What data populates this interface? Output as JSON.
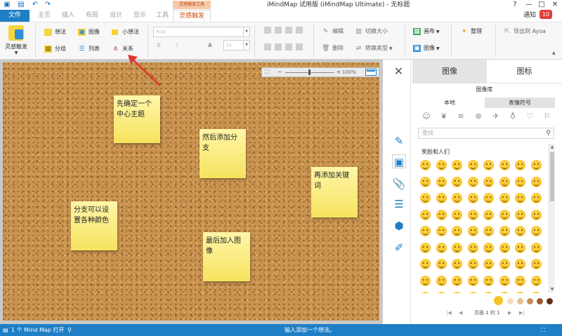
{
  "window": {
    "title": "iMindMap 试用版 (iMindMap Ultimate) - 无标题",
    "context_tab_group": "灵感触发工具",
    "help": "?",
    "minimize": "—",
    "maximize": "□",
    "close": "✕"
  },
  "tabs": {
    "file": "文件",
    "home": "主页",
    "insert": "插入",
    "layout": "布局",
    "design": "设计",
    "view": "显示",
    "tools": "工具",
    "active": "灵感触发"
  },
  "notify": {
    "label": "通知",
    "count": "10"
  },
  "ribbon": {
    "big_button": "灵感触发",
    "idea": "想法",
    "image": "图像",
    "small_idea": "小想法",
    "group": "分组",
    "list": "列表",
    "relation": "关系",
    "font_placeholder": "Arial",
    "font_size": "12",
    "bold": "B",
    "italic": "I",
    "edit": "编辑",
    "delete": "删除",
    "toggle_size": "切换大小",
    "convert_type": "转换类型",
    "layout_menu": "画布",
    "image_menu": "图像",
    "organize": "整理",
    "export": "导出到 Ayoa"
  },
  "zoom": {
    "level": "100%",
    "minus": "−",
    "plus": "+"
  },
  "notes": [
    {
      "text": "先确定一个中心主题"
    },
    {
      "text": "然后添加分支"
    },
    {
      "text": "再添加关键词"
    },
    {
      "text": "分支可以设置各种颜色"
    },
    {
      "text": "最后加入图像"
    }
  ],
  "panel": {
    "close": "✕",
    "tab_images": "图像",
    "tab_icons": "图标",
    "library_title": "图像库",
    "sub_local": "本地",
    "sub_emoji": "表情符号",
    "search_placeholder": "查找",
    "category_title": "笑脸和人们",
    "pager": "页面 1 的 1",
    "first": "|◀",
    "prev": "◀",
    "next": "▶",
    "last": "▶|"
  },
  "colors": {
    "accent": "#1e7fc6",
    "active_tab": "#c8541c",
    "badge": "#e2403a",
    "note": "#f8ec7a",
    "cork": "#c8934f",
    "arrow": "#e0342c"
  },
  "status": {
    "left": "1 个 Mind Map 打开",
    "center": "输入添加一个想法。"
  }
}
